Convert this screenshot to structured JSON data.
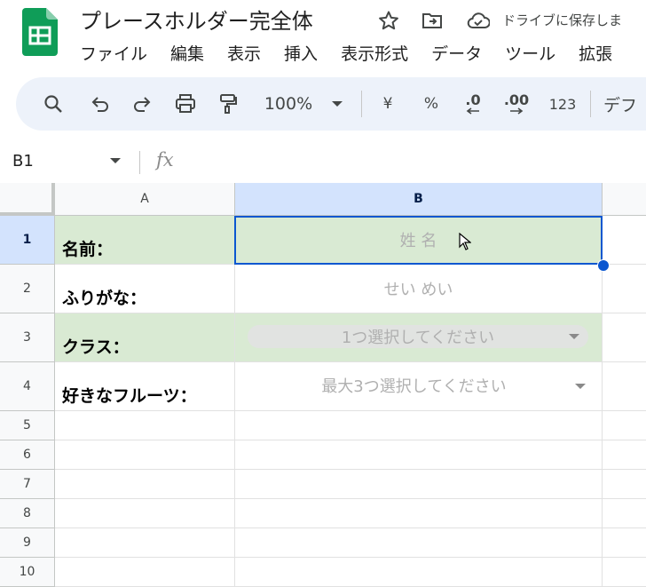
{
  "header": {
    "title": "プレースホルダー完全体",
    "save_status": "ドライブに保存しま"
  },
  "menu": [
    "ファイル",
    "編集",
    "表示",
    "挿入",
    "表示形式",
    "データ",
    "ツール",
    "拡張"
  ],
  "toolbar": {
    "zoom": "100%",
    "currency": "¥",
    "percent": "%",
    "decrease_decimal": ".0",
    "increase_decimal": ".00",
    "number_format": "123",
    "font_partial": "デフ"
  },
  "formula_bar": {
    "name_box": "B1",
    "fx": "fx"
  },
  "grid": {
    "columns": [
      "A",
      "B"
    ],
    "rows": [
      "1",
      "2",
      "3",
      "4",
      "5",
      "6",
      "7",
      "8",
      "9",
      "10"
    ],
    "labels": {
      "r1": "名前：",
      "r2": "ふりがな：",
      "r3": "クラス：",
      "r4": "好きなフルーツ："
    },
    "placeholders": {
      "r1": "姓 名",
      "r2": "せい めい",
      "r3": "1つ選択してください",
      "r4": "最大3つ選択してください"
    },
    "selected_cell": "B1",
    "colors": {
      "highlight_green": "#d9ead3",
      "selection_blue": "#0b57d0",
      "selected_header": "#d3e3fd"
    }
  }
}
